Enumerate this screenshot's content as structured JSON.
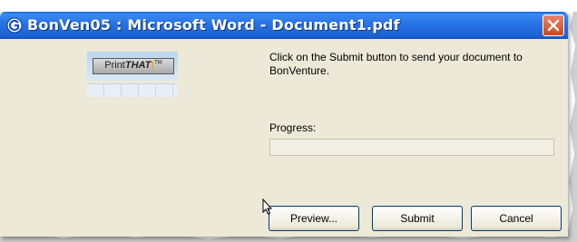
{
  "window": {
    "title": "BonVen05 : Microsoft Word - Document1.pdf",
    "title_bar_color": "#2a74e6",
    "app_icon": "bonventure-g-icon",
    "close_icon": "close-x-icon"
  },
  "logo": {
    "prefix": "Print",
    "brand": "THAT",
    "mark": "!",
    "tm": "TM"
  },
  "instructions": "Click on the Submit button to send your document to BonVenture.",
  "progress": {
    "label": "Progress:",
    "value": 0
  },
  "buttons": {
    "preview": "Preview...",
    "submit": "Submit",
    "cancel": "Cancel"
  }
}
